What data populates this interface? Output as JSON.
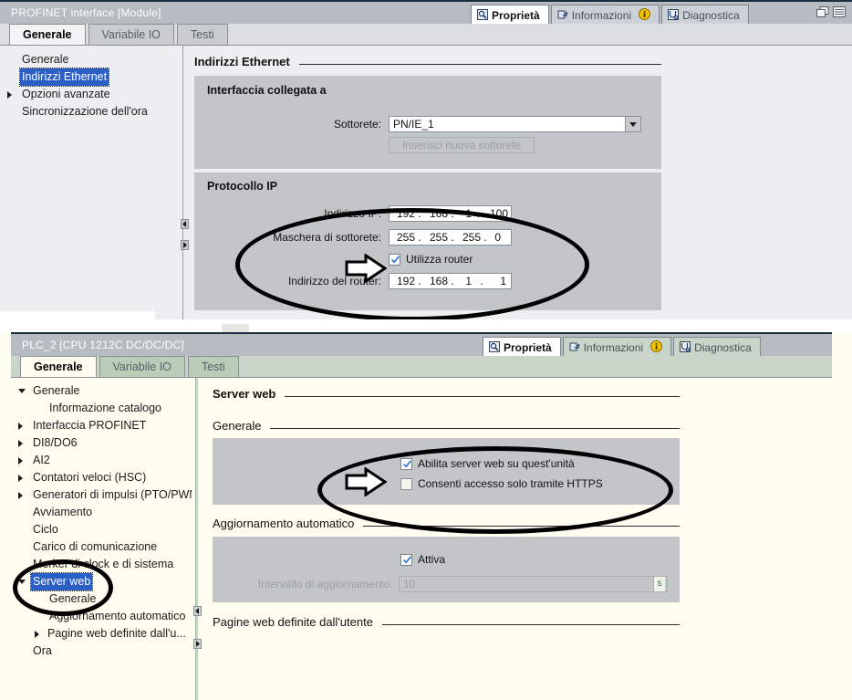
{
  "top_panel": {
    "title": "PROFINET interface [Module]",
    "view_tabs": [
      {
        "label": "Proprietà",
        "icon": "properties-icon",
        "selected": true,
        "badge": null
      },
      {
        "label": "Informazioni",
        "icon": "information-icon",
        "selected": false,
        "badge": "i"
      },
      {
        "label": "Diagnostica",
        "icon": "diagnostics-icon",
        "selected": false,
        "badge": null
      }
    ],
    "window_buttons": [
      {
        "name": "restore-window-icon"
      },
      {
        "name": "list-view-icon"
      }
    ],
    "tabs": [
      {
        "label": "Generale",
        "selected": true
      },
      {
        "label": "Variabile IO",
        "selected": false
      },
      {
        "label": "Testi",
        "selected": false
      }
    ],
    "tree": [
      {
        "label": "Generale",
        "level": 0,
        "twisty": "none",
        "selected": false
      },
      {
        "label": "Indirizzi Ethernet",
        "level": 0,
        "twisty": "none",
        "selected": true
      },
      {
        "label": "Opzioni avanzate",
        "level": 0,
        "twisty": "closed",
        "selected": false
      },
      {
        "label": "Sincronizzazione dell'ora",
        "level": 0,
        "twisty": "none",
        "selected": false
      }
    ],
    "content": {
      "page_title": "Indirizzi Ethernet",
      "group_interface": {
        "title": "Interfaccia collegata a",
        "subnet_label": "Sottorete:",
        "subnet_value": "PN/IE_1",
        "add_subnet_button": "Inserisci nuova sottorete"
      },
      "group_ip": {
        "title": "Protocollo IP",
        "ip_label": "Indirizzo IP:",
        "ip_value": [
          "192",
          "168",
          "1",
          "100"
        ],
        "mask_label": "Maschera di sottorete:",
        "mask_value": [
          "255",
          "255",
          "255",
          "0"
        ],
        "use_router_label": "Utilizza router",
        "use_router_checked": true,
        "router_label": "Indirizzo del router:",
        "router_value": [
          "192",
          "168",
          "1",
          "1"
        ]
      }
    }
  },
  "bottom_panel": {
    "title": "PLC_2 [CPU 1212C DC/DC/DC]",
    "view_tabs": [
      {
        "label": "Proprietà",
        "icon": "properties-icon",
        "selected": true,
        "badge": null
      },
      {
        "label": "Informazioni",
        "icon": "information-icon",
        "selected": false,
        "badge": "i"
      },
      {
        "label": "Diagnostica",
        "icon": "diagnostics-icon",
        "selected": false,
        "badge": null
      }
    ],
    "tabs": [
      {
        "label": "Generale",
        "selected": true
      },
      {
        "label": "Variabile IO",
        "selected": false
      },
      {
        "label": "Testi",
        "selected": false
      }
    ],
    "tree": [
      {
        "label": "Generale",
        "level": 0,
        "twisty": "open",
        "selected": false
      },
      {
        "label": "Informazione catalogo",
        "level": 1,
        "twisty": "none",
        "selected": false
      },
      {
        "label": "Interfaccia PROFINET",
        "level": 0,
        "twisty": "closed",
        "selected": false
      },
      {
        "label": "DI8/DO6",
        "level": 0,
        "twisty": "closed",
        "selected": false
      },
      {
        "label": "AI2",
        "level": 0,
        "twisty": "closed",
        "selected": false
      },
      {
        "label": "Contatori veloci (HSC)",
        "level": 0,
        "twisty": "closed",
        "selected": false
      },
      {
        "label": "Generatori di impulsi (PTO/PWM)",
        "level": 0,
        "twisty": "closed",
        "selected": false
      },
      {
        "label": "Avviamento",
        "level": 0,
        "twisty": "none",
        "selected": false
      },
      {
        "label": "Ciclo",
        "level": 0,
        "twisty": "none",
        "selected": false
      },
      {
        "label": "Carico di comunicazione",
        "level": 0,
        "twisty": "none",
        "selected": false
      },
      {
        "label": "Merker di clock e di sistema",
        "level": 0,
        "twisty": "none",
        "selected": false
      },
      {
        "label": "Server web",
        "level": 0,
        "twisty": "open",
        "selected": true
      },
      {
        "label": "Generale",
        "level": 1,
        "twisty": "none",
        "selected": false
      },
      {
        "label": "Aggiornamento automatico",
        "level": 1,
        "twisty": "none",
        "selected": false
      },
      {
        "label": "Pagine web definite dall'u...",
        "level": 1,
        "twisty": "closed",
        "selected": false
      },
      {
        "label": "Ora",
        "level": 0,
        "twisty": "none",
        "selected": false
      }
    ],
    "content": {
      "page_title": "Server web",
      "section_general": "Generale",
      "enable_web_server_label": "Abilita server web su quest'unità",
      "enable_web_server_checked": true,
      "https_only_label": "Consenti accesso solo tramite HTTPS",
      "https_only_checked": false,
      "section_autoupdate": "Aggiornamento automatico",
      "activate_label": "Attiva",
      "activate_checked": true,
      "interval_label": "Intervallo di aggiornamento:",
      "interval_value": "10",
      "interval_unit": "s",
      "section_userpages": "Pagine web definite dall'utente"
    }
  },
  "annotations": {
    "top_ellipse": "highlight-ip-settings",
    "top_arrow": "pointer-use-router",
    "bottom_ellipse_content": "highlight-web-server-checkboxes",
    "bottom_arrow": "pointer-enable-web-server",
    "bottom_ellipse_tree": "highlight-server-web-tree-node"
  },
  "colors": {
    "titlebar": "#b6bcc2",
    "selection": "#2b5fc6",
    "group_bg": "#c3c6c9",
    "bottom_panel_bg": "#fffdf0",
    "annotation": "#000000",
    "check_blue": "#2f77d8"
  }
}
